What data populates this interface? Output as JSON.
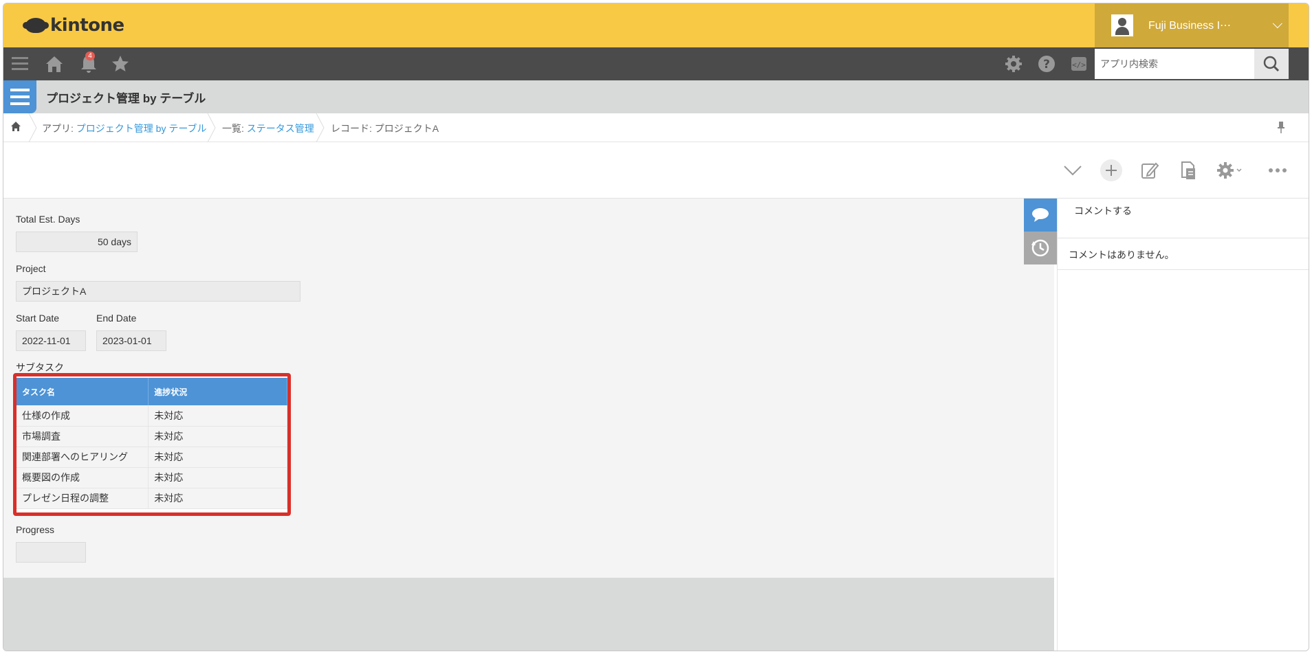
{
  "header": {
    "logo_text": "kintone",
    "user_name": "Fuji Business I⋯"
  },
  "toolbar": {
    "notification_count": "4",
    "search_placeholder": "アプリ内検索"
  },
  "app": {
    "title": "プロジェクト管理 by テーブル"
  },
  "breadcrumb": {
    "app_prefix": "アプリ: ",
    "app_link": "プロジェクト管理 by テーブル",
    "view_prefix": "一覧: ",
    "view_link": "ステータス管理",
    "record_label": "レコード: プロジェクトA"
  },
  "record": {
    "total_est_days": {
      "label": "Total Est. Days",
      "value": "50 days"
    },
    "project": {
      "label": "Project",
      "value": "プロジェクトA"
    },
    "start_date": {
      "label": "Start Date",
      "value": "2022-11-01"
    },
    "end_date": {
      "label": "End Date",
      "value": "2023-01-01"
    },
    "subtable": {
      "label": "サブタスク",
      "columns": [
        "タスク名",
        "進捗状況"
      ],
      "rows": [
        [
          "仕様の作成",
          "未対応"
        ],
        [
          "市場調査",
          "未対応"
        ],
        [
          "関連部署へのヒアリング",
          "未対応"
        ],
        [
          "概要図の作成",
          "未対応"
        ],
        [
          "プレゼン日程の調整",
          "未対応"
        ]
      ]
    },
    "progress": {
      "label": "Progress",
      "value": ""
    }
  },
  "comments": {
    "input_placeholder": "コメントする",
    "empty_message": "コメントはありません。"
  },
  "colors": {
    "header": "#f8c945",
    "toolbar": "#4b4b4b",
    "accent": "#4d93d6",
    "highlight_border": "#d92f2a"
  }
}
